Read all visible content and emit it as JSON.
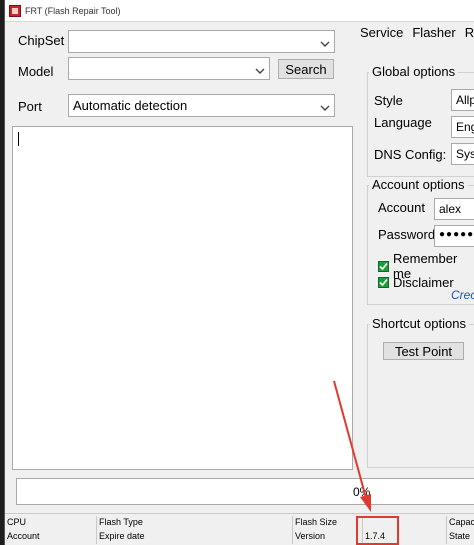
{
  "window": {
    "title": "FRT (Flash Repair Tool)"
  },
  "form": {
    "chipset_label": "ChipSet",
    "chipset_value": "",
    "model_label": "Model",
    "model_value": "",
    "search_button": "Search",
    "port_label": "Port",
    "port_value": "Automatic detection"
  },
  "tabs": [
    {
      "label": "Service"
    },
    {
      "label": "Flasher"
    },
    {
      "label": "Re"
    }
  ],
  "global_options": {
    "title": "Global options",
    "style_label": "Style",
    "style_value": "Allp",
    "language_label": "Language",
    "language_value": "Engl",
    "dns_label": "DNS Config:",
    "dns_value": "Syst"
  },
  "account_options": {
    "title": "Account options",
    "account_label": "Account",
    "account_value": "alex",
    "password_label": "Password",
    "password_value": "●●●●●●",
    "remember_label": "Remember me",
    "remember_checked": true,
    "disclaimer_label": "Disclaimer",
    "disclaimer_checked": true,
    "link_text": "Creo"
  },
  "shortcut_options": {
    "title": "Shortcut options",
    "test_point_button": "Test Point"
  },
  "progress": {
    "label": "0%",
    "value": 0
  },
  "statusbar": {
    "cpu": "CPU",
    "account": "Account",
    "flash_type": "Flash Type",
    "expire_date": "Expire date",
    "flash_size": "Flash Size",
    "version_label": "Version",
    "version_value": "1.7.4",
    "capacity": "Capac",
    "state": "State"
  },
  "colors": {
    "check_green": "#1a9e3a",
    "link_blue": "#1f4fb5",
    "annotation_red": "#e03a2f"
  }
}
